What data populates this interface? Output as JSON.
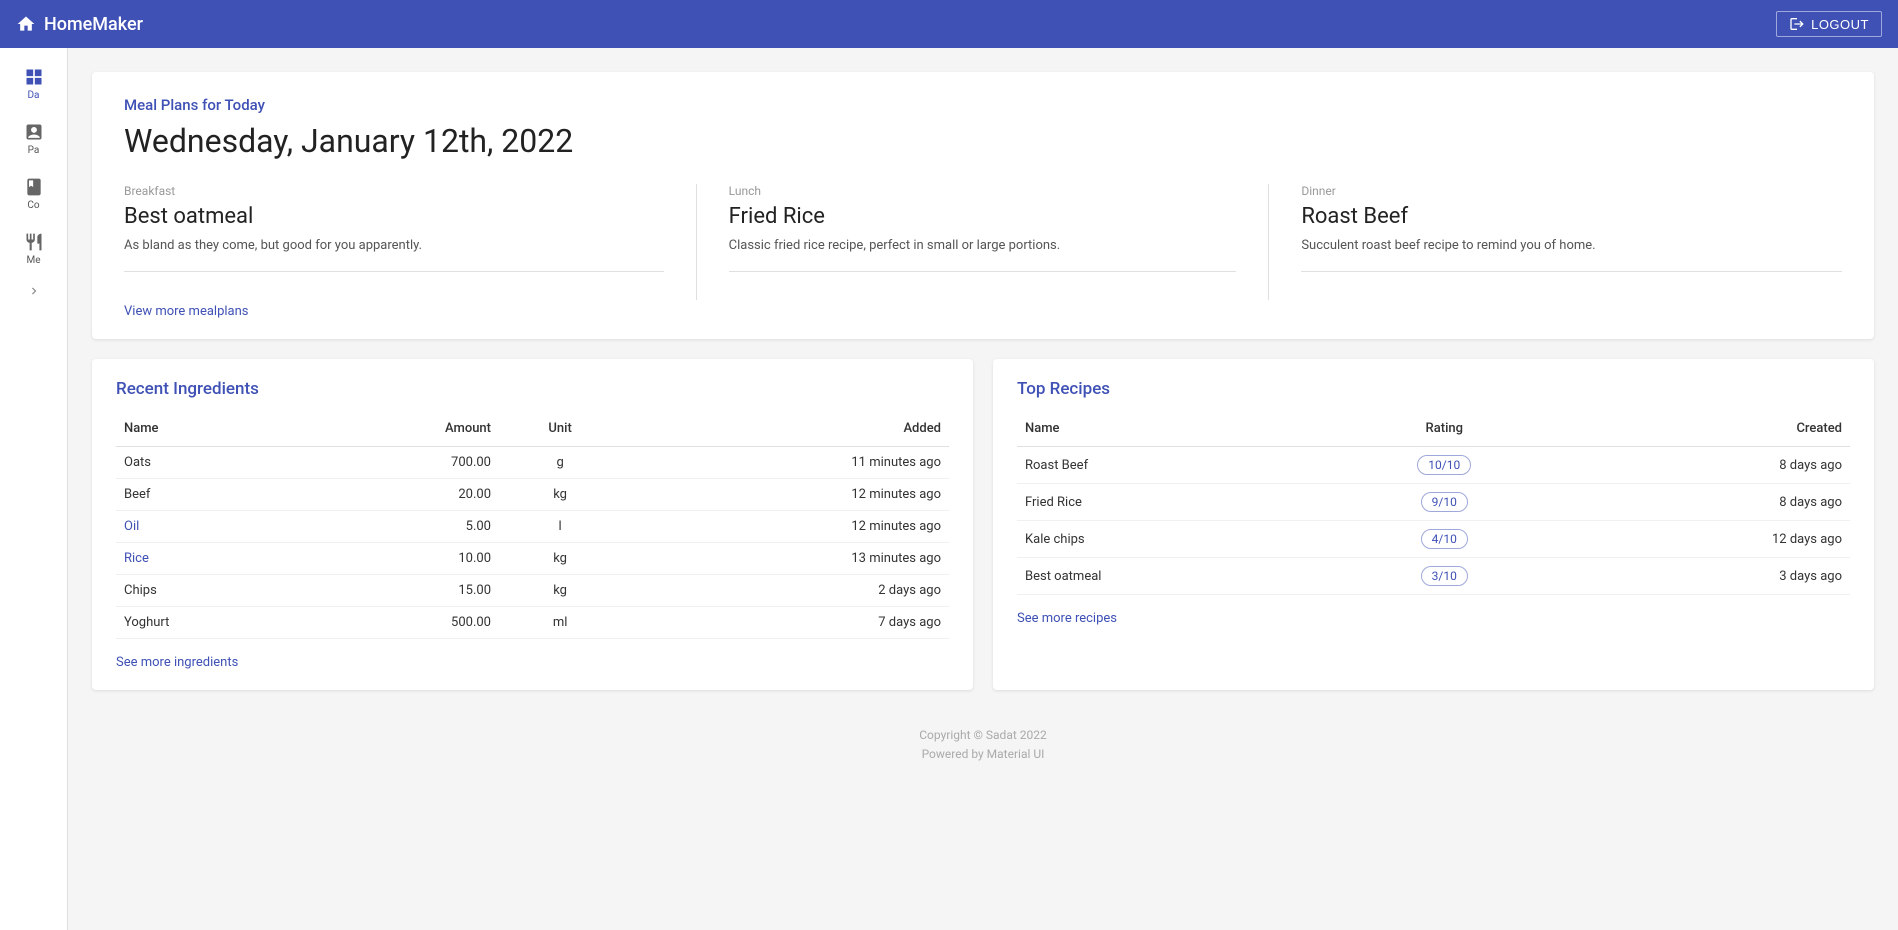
{
  "app": {
    "title": "HomeMaker",
    "logout_label": "LOGOUT"
  },
  "sidebar": {
    "items": [
      {
        "id": "dashboard",
        "label": "Da",
        "active": true
      },
      {
        "id": "pantry",
        "label": "Pa",
        "active": false
      },
      {
        "id": "cookbook",
        "label": "Co",
        "active": false
      },
      {
        "id": "mealplan",
        "label": "Me",
        "active": false
      }
    ]
  },
  "meal_plan": {
    "title": "Meal Plans for Today",
    "date": "Wednesday, January 12th, 2022",
    "meals": [
      {
        "type": "Breakfast",
        "name": "Best oatmeal",
        "description": "As bland as they come, but good for you apparently."
      },
      {
        "type": "Lunch",
        "name": "Fried Rice",
        "description": "Classic fried rice recipe, perfect in small or large portions."
      },
      {
        "type": "Dinner",
        "name": "Roast Beef",
        "description": "Succulent roast beef recipe to remind you of home."
      }
    ],
    "view_more_label": "View more mealplans"
  },
  "recent_ingredients": {
    "title": "Recent Ingredients",
    "columns": {
      "name": "Name",
      "amount": "Amount",
      "unit": "Unit",
      "added": "Added"
    },
    "rows": [
      {
        "name": "Oats",
        "amount": "700.00",
        "unit": "g",
        "added": "11 minutes ago",
        "link": false
      },
      {
        "name": "Beef",
        "amount": "20.00",
        "unit": "kg",
        "added": "12 minutes ago",
        "link": false
      },
      {
        "name": "Oil",
        "amount": "5.00",
        "unit": "l",
        "added": "12 minutes ago",
        "link": true
      },
      {
        "name": "Rice",
        "amount": "10.00",
        "unit": "kg",
        "added": "13 minutes ago",
        "link": true
      },
      {
        "name": "Chips",
        "amount": "15.00",
        "unit": "kg",
        "added": "2 days ago",
        "link": false
      },
      {
        "name": "Yoghurt",
        "amount": "500.00",
        "unit": "ml",
        "added": "7 days ago",
        "link": false
      }
    ],
    "see_more_label": "See more ingredients"
  },
  "top_recipes": {
    "title": "Top Recipes",
    "columns": {
      "name": "Name",
      "rating": "Rating",
      "created": "Created"
    },
    "rows": [
      {
        "name": "Roast Beef",
        "rating": "10/10",
        "created": "8 days ago"
      },
      {
        "name": "Fried Rice",
        "rating": "9/10",
        "created": "8 days ago"
      },
      {
        "name": "Kale chips",
        "rating": "4/10",
        "created": "12 days ago"
      },
      {
        "name": "Best oatmeal",
        "rating": "3/10",
        "created": "3 days ago"
      }
    ],
    "see_more_label": "See more recipes"
  },
  "footer": {
    "copyright": "Copyright © Sadat 2022",
    "powered_by": "Powered by Material UI"
  }
}
